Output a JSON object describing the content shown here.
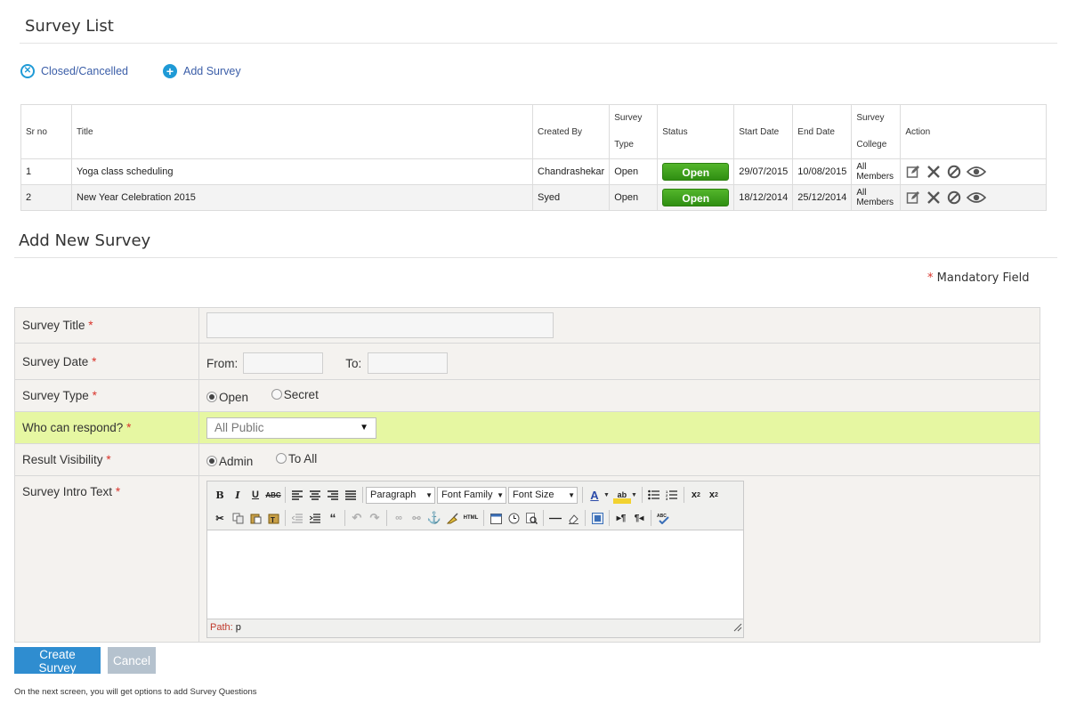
{
  "survey_list": {
    "title": "Survey List",
    "links": {
      "closed": "Closed/Cancelled",
      "add": "Add Survey"
    },
    "columns": {
      "sr": "Sr no",
      "title": "Title",
      "created_by": "Created By",
      "type_1": "Survey",
      "type_2": "Type",
      "status": "Status",
      "start": "Start Date",
      "end": "End Date",
      "college_1": "Survey",
      "college_2": "College",
      "action": "Action"
    },
    "rows": [
      {
        "sr": "1",
        "title": "Yoga class scheduling",
        "created_by": "Chandrashekar",
        "type": "Open",
        "status": "Open",
        "start": "29/07/2015",
        "end": "10/08/2015",
        "college_1": "All",
        "college_2": "Members"
      },
      {
        "sr": "2",
        "title": "New Year Celebration 2015",
        "created_by": "Syed",
        "type": "Open",
        "status": "Open",
        "start": "18/12/2014",
        "end": "25/12/2014",
        "college_1": "All",
        "college_2": "Members"
      }
    ]
  },
  "add_survey": {
    "title": "Add New Survey",
    "mandatory": "Mandatory Field",
    "required_mark": "*",
    "fields": {
      "title_label": "Survey Title",
      "date_label": "Survey Date",
      "from": "From:",
      "to": "To:",
      "type_label": "Survey Type",
      "type_open": "Open",
      "type_secret": "Secret",
      "respond_label": "Who can respond?",
      "respond_value": "All Public",
      "visibility_label": "Result Visibility",
      "vis_admin": "Admin",
      "vis_all": "To All",
      "intro_label": "Survey Intro Text"
    },
    "editor": {
      "format": "Paragraph",
      "font_family": "Font Family",
      "font_size": "Font Size",
      "path_label": "Path:",
      "path_value": "p"
    },
    "buttons": {
      "create": "Create Survey",
      "cancel": "Cancel"
    },
    "note": "On the next screen, you will get options to add Survey Questions"
  },
  "colors": {
    "accent": "#2f8dd0",
    "status_green": "#3fa21c",
    "highlight_row": "#e6f7a2",
    "required": "#d9342b"
  }
}
